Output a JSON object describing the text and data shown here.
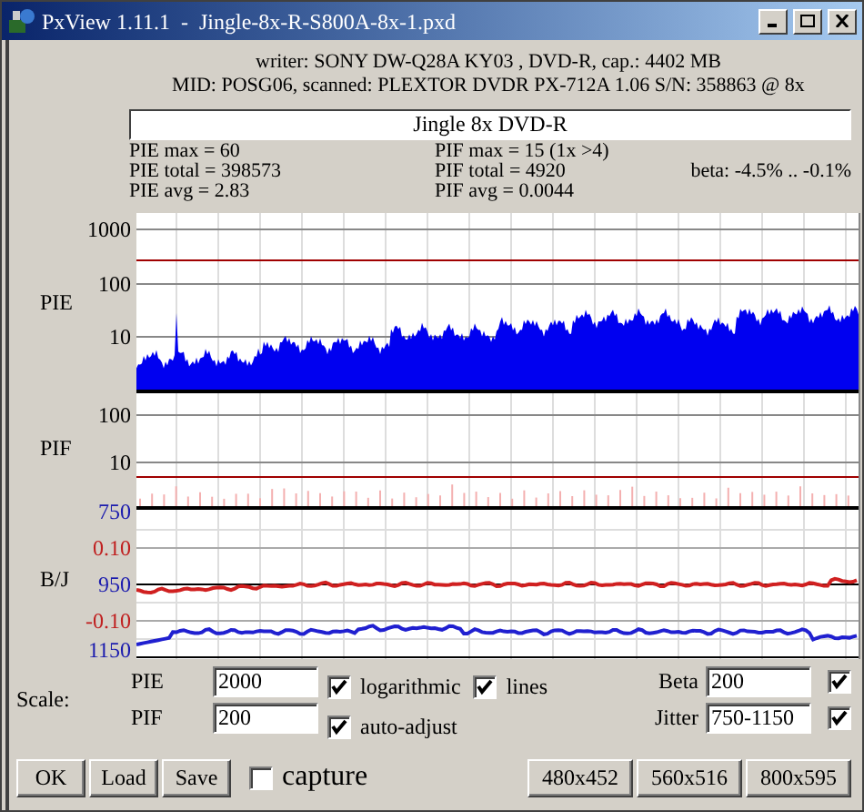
{
  "window": {
    "title": "PxView 1.11.1  -  Jingle-8x-R-S800A-8x-1.pxd"
  },
  "info": [
    "writer: SONY DW-Q28A KY03 , DVD-R, cap.: 4402 MB",
    "MID: POSG06, scanned: PLEXTOR DVDR PX-712A 1.06 S/N: 358863 @ 8x"
  ],
  "disc_label": {
    "value": "Jingle 8x DVD-R"
  },
  "stats": [
    [
      "PIE max = 60",
      "PIF max = 15 (1x >4)"
    ],
    [
      "PIE total = 398573",
      "PIF total = 4920",
      "beta: -4.5% .. -0.1%"
    ],
    [
      "PIE avg = 2.83",
      "PIF avg = 0.0044"
    ]
  ],
  "graphs": {
    "pie": {
      "label": "PIE",
      "ticks": [
        "1000",
        "100",
        "10"
      ]
    },
    "pif": {
      "label": "PIF",
      "ticks": [
        "100",
        "10"
      ]
    },
    "bj": {
      "label": "B/J",
      "ticks": [
        {
          "text": "750",
          "color": "#1c1cae"
        },
        {
          "text": "0.10",
          "color": "#c02020"
        },
        {
          "text": "950",
          "color": "#1c1cae"
        },
        {
          "text": "-0.10",
          "color": "#c02020"
        },
        {
          "text": "1150",
          "color": "#1c1cae"
        }
      ]
    }
  },
  "scale": {
    "label": "Scale:",
    "fields": [
      {
        "label": "PIE",
        "value": "2000"
      },
      {
        "label": "PIF",
        "value": "200"
      }
    ],
    "options": [
      {
        "label": "logarithmic",
        "checked": true
      },
      {
        "label": "lines",
        "checked": true
      },
      {
        "label": "auto-adjust",
        "checked": true
      }
    ],
    "right": [
      {
        "label": "Beta",
        "value": "200",
        "checked": true
      },
      {
        "label": "Jitter",
        "value": "750-1150",
        "checked": true
      }
    ]
  },
  "buttons": [
    "OK",
    "Load",
    "Save"
  ],
  "capture": {
    "label": "capture",
    "checked": false
  },
  "sizes": [
    "480x452",
    "560x516",
    "800x595"
  ]
}
